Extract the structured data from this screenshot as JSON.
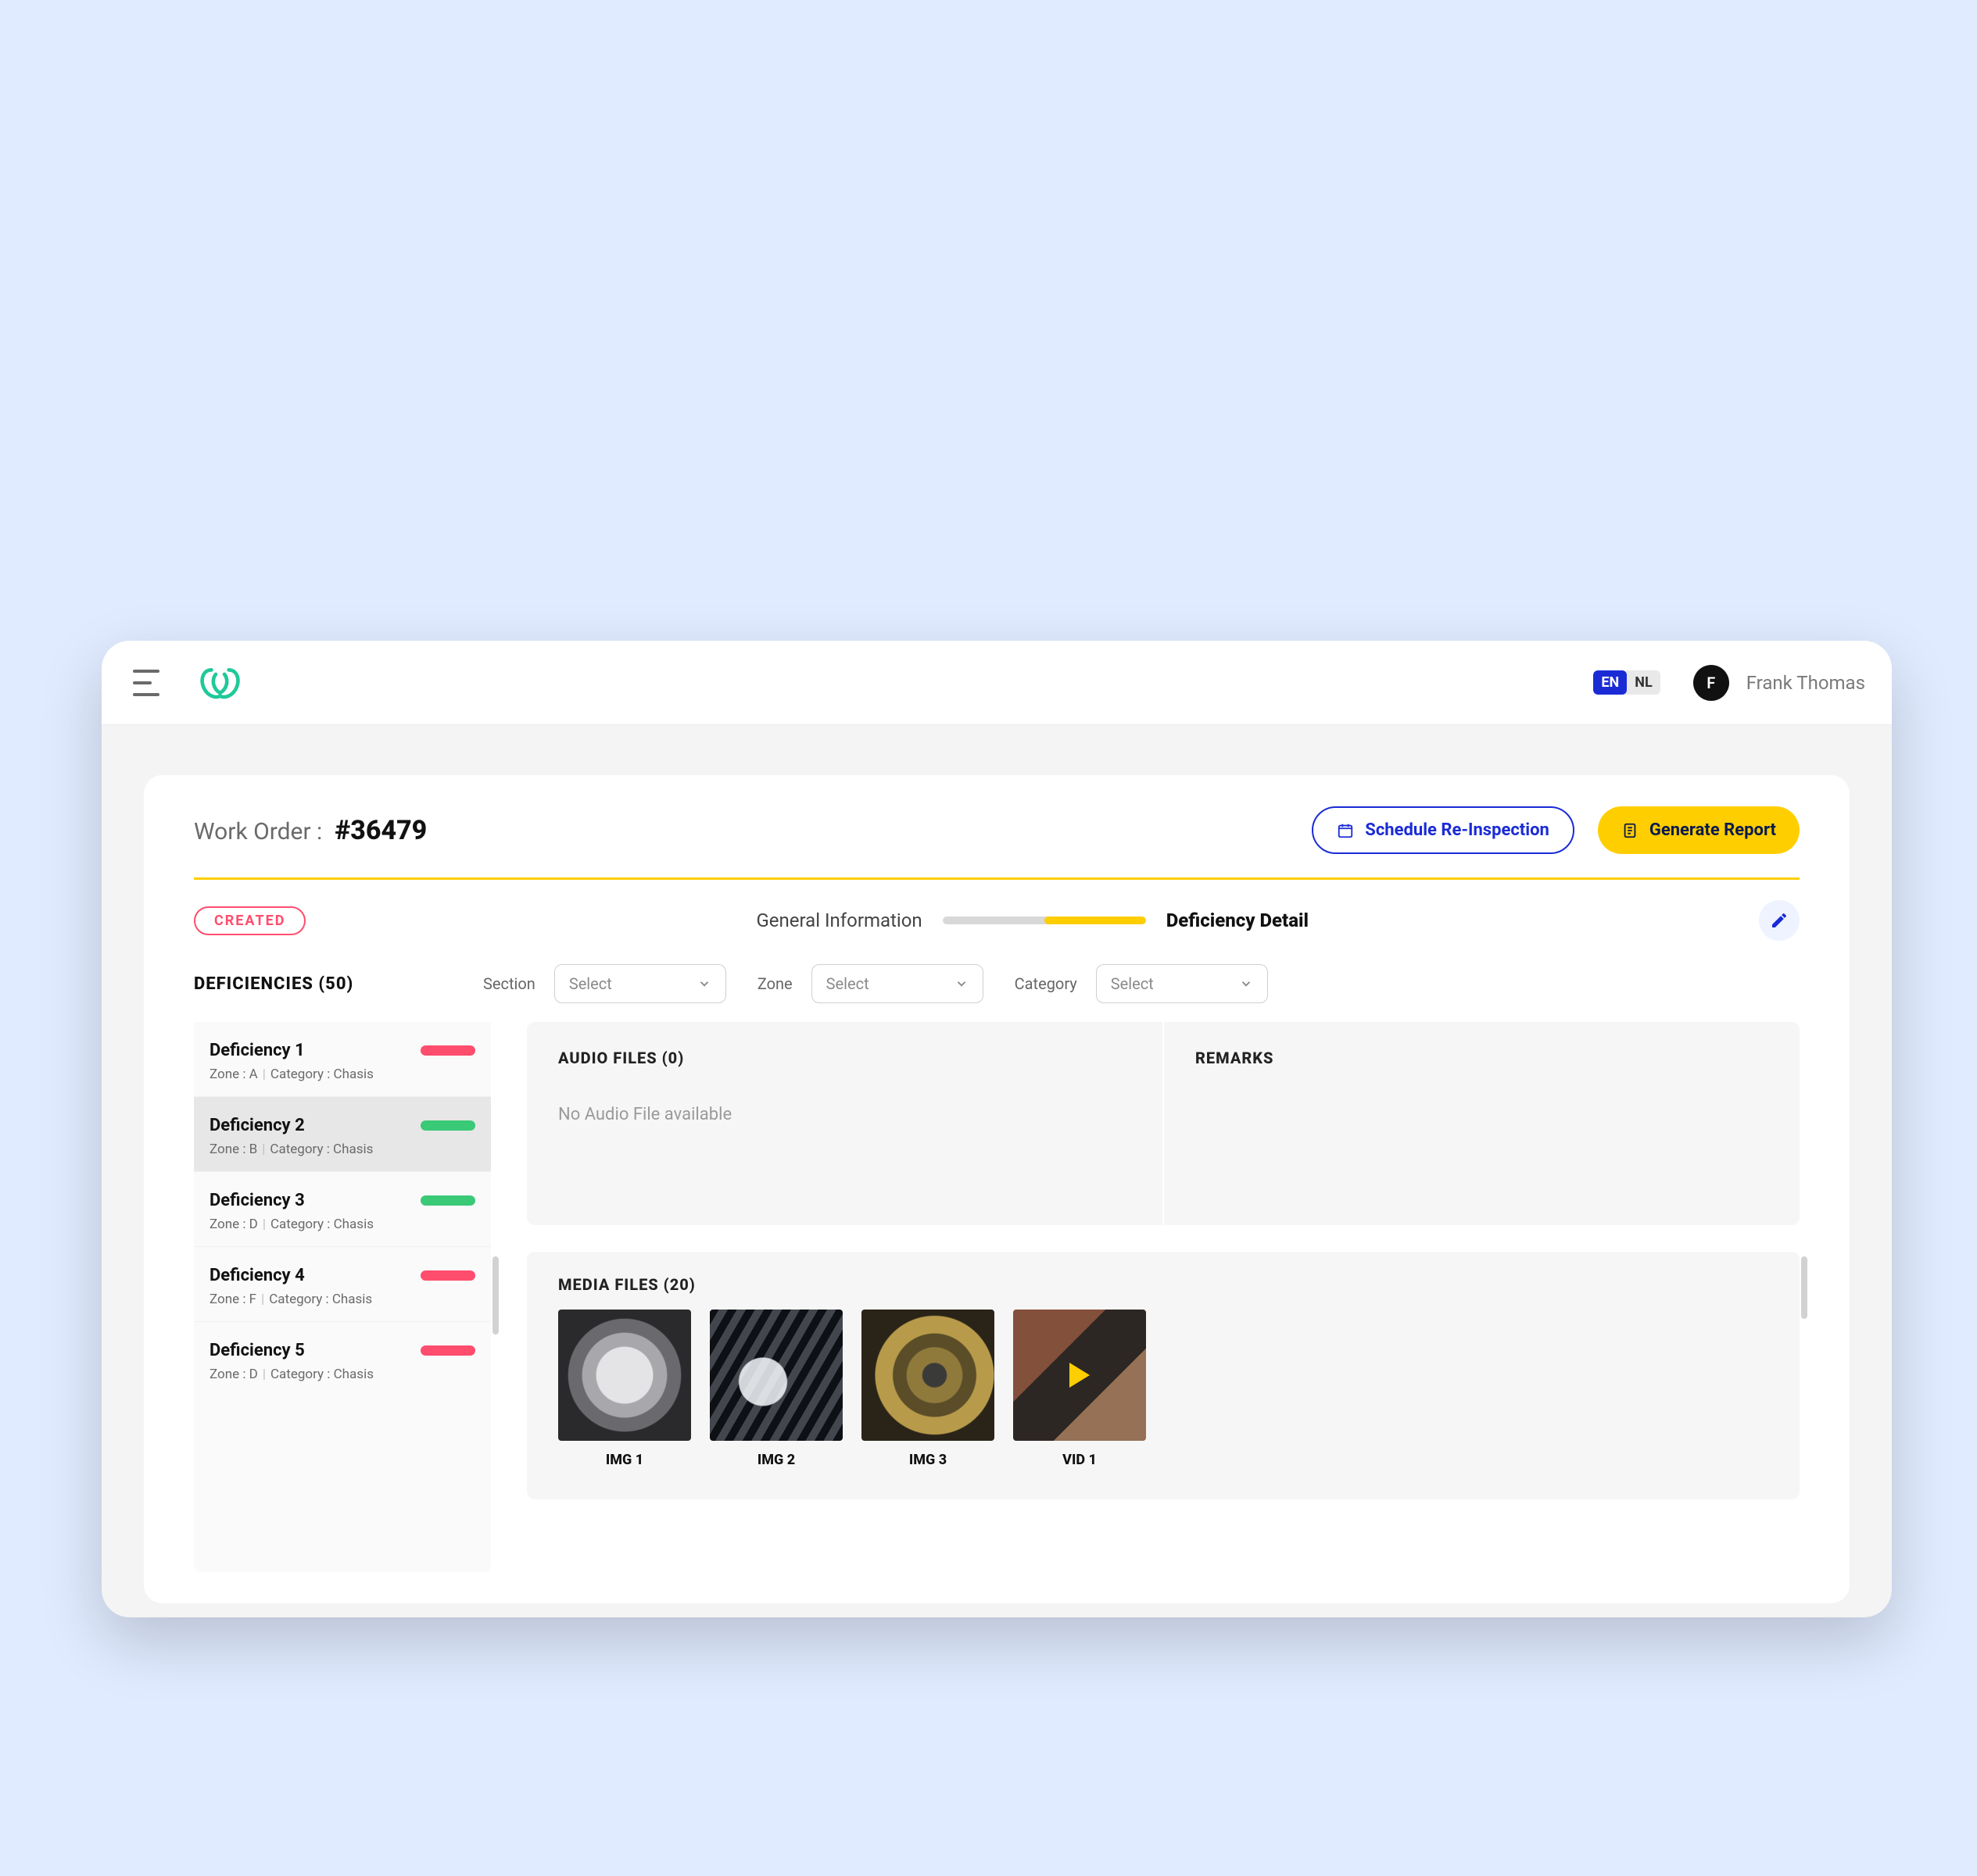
{
  "header": {
    "lang_active": "EN",
    "lang_inactive": "NL",
    "user_initial": "F",
    "user_name": "Frank Thomas"
  },
  "work_order": {
    "label": "Work Order :",
    "number": "#36479",
    "status": "CREATED"
  },
  "actions": {
    "schedule": "Schedule Re-Inspection",
    "report": "Generate Report"
  },
  "tabs": {
    "general": "General Information",
    "detail": "Deficiency Detail"
  },
  "deficiencies_heading": "DEFICIENCIES (50)",
  "filters": {
    "section_label": "Section",
    "section_value": "Select",
    "zone_label": "Zone",
    "zone_value": "Select",
    "category_label": "Category",
    "category_value": "Select"
  },
  "deficiency_list": [
    {
      "title": "Deficiency 1",
      "zone": "A",
      "category": "Chasis",
      "status": "red",
      "selected": false
    },
    {
      "title": "Deficiency 2",
      "zone": "B",
      "category": "Chasis",
      "status": "green",
      "selected": true
    },
    {
      "title": "Deficiency 3",
      "zone": "D",
      "category": "Chasis",
      "status": "green",
      "selected": false
    },
    {
      "title": "Deficiency 4",
      "zone": "F",
      "category": "Chasis",
      "status": "red",
      "selected": false
    },
    {
      "title": "Deficiency 5",
      "zone": "D",
      "category": "Chasis",
      "status": "red",
      "selected": false
    }
  ],
  "sub_template": {
    "zone_prefix": "Zone : ",
    "cat_prefix": "Category : "
  },
  "audio": {
    "title": "AUDIO FILES (0)",
    "empty": "No Audio File available"
  },
  "remarks": {
    "title": "REMARKS"
  },
  "media": {
    "title": "MEDIA FILES (20)",
    "items": [
      {
        "caption": "IMG 1",
        "kind": "image"
      },
      {
        "caption": "IMG 2",
        "kind": "image"
      },
      {
        "caption": "IMG 3",
        "kind": "image"
      },
      {
        "caption": "VID 1",
        "kind": "video"
      }
    ]
  }
}
